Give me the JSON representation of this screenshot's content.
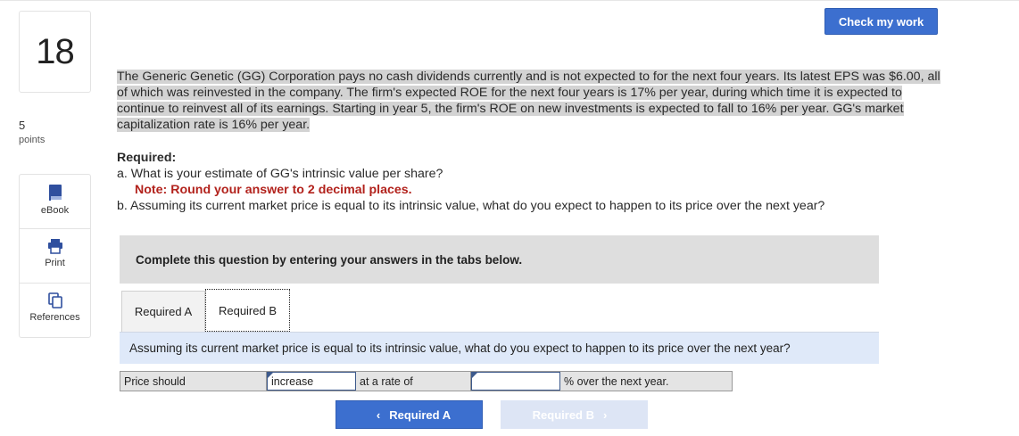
{
  "question": {
    "number": "18",
    "points_value": "5",
    "points_label": "points"
  },
  "tools": [
    {
      "label": "eBook",
      "icon": "book-icon"
    },
    {
      "label": "Print",
      "icon": "printer-icon"
    },
    {
      "label": "References",
      "icon": "copy-icon"
    }
  ],
  "header": {
    "check_label": "Check my work"
  },
  "body": {
    "problem_text": "The Generic Genetic (GG) Corporation pays no cash dividends currently and is not expected to for the next four years. Its latest EPS was $6.00, all of which was reinvested in the company. The firm's expected ROE for the next four years is 17% per year, during which time it is  expected to continue to reinvest all of its earnings. Starting in year 5, the firm's ROE on new investments is expected to fall to 16% per year. GG's market capitalization rate is 16% per year.",
    "required_title": "Required:",
    "req_a": "a. What is your estimate of GG's intrinsic value per share?",
    "req_a_note": "Note: Round your answer to 2 decimal places.",
    "req_b": "b. Assuming its current market price is equal to its intrinsic value, what do you expect to happen to its price over the next year?"
  },
  "instructions": "Complete this question by entering your answers in the tabs below.",
  "tabs": [
    {
      "label": "Required A"
    },
    {
      "label": "Required B"
    }
  ],
  "active_tab_prompt": "Assuming its current market price is equal to its intrinsic value, what do you expect to happen to its price over the next year?",
  "answer_row": {
    "label1": "Price should",
    "select_value": "increase",
    "label2": "at a rate of",
    "rate_value": "",
    "label3": "% over the next year."
  },
  "nav": {
    "prev_label": "Required A",
    "next_label": "Required B"
  },
  "colors": {
    "accent": "#3c6fcf",
    "note_red": "#b2221c",
    "prompt_bg": "#dfe9f9"
  }
}
